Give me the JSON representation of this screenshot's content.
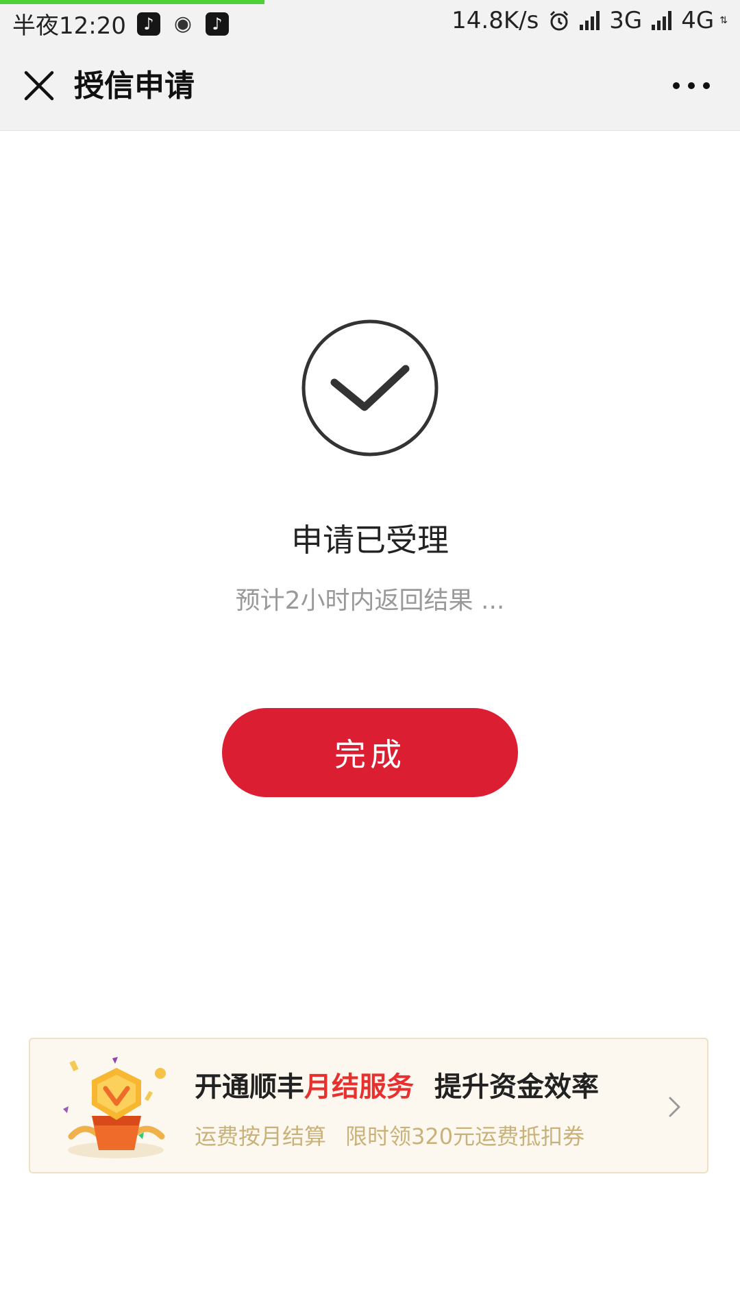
{
  "status_bar": {
    "time": "半夜12:20",
    "net_speed": "14.8K/s",
    "network_1": "3G",
    "network_2": "4G",
    "data_arrows": "⇅"
  },
  "header": {
    "title": "授信申请"
  },
  "result": {
    "title": "申请已受理",
    "subtitle": "预计2小时内返回结果 ..."
  },
  "actions": {
    "done_label": "完成"
  },
  "banner": {
    "line1_part1": "开通顺丰",
    "line1_highlight": "月结服务",
    "line1_part2": "提升资金效率",
    "line2_part1": "运费按月结算",
    "line2_part2": "限时领320元运费抵扣券"
  },
  "colors": {
    "primary": "#dc1e32",
    "highlight": "#e8312f",
    "banner_bg": "#fdf8ef",
    "banner_subtext": "#c9b27a"
  }
}
